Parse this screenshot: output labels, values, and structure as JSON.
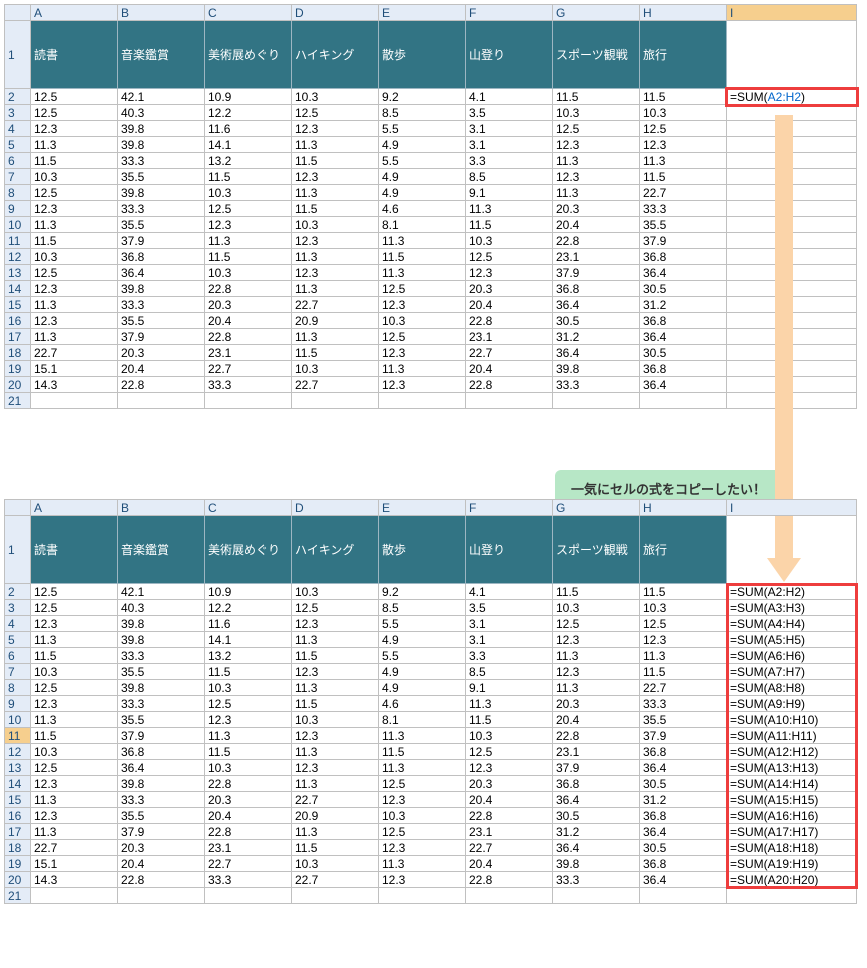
{
  "columns": [
    "A",
    "B",
    "C",
    "D",
    "E",
    "F",
    "G",
    "H",
    "I"
  ],
  "headers": [
    "読書",
    "音楽鑑賞",
    "美術展めぐり",
    "ハイキング",
    "散歩",
    "山登り",
    "スポーツ観戦",
    "旅行"
  ],
  "rows": [
    [
      "12.5",
      "42.1",
      "10.9",
      "10.3",
      "9.2",
      "4.1",
      "11.5",
      "11.5"
    ],
    [
      "12.5",
      "40.3",
      "12.2",
      "12.5",
      "8.5",
      "3.5",
      "10.3",
      "10.3"
    ],
    [
      "12.3",
      "39.8",
      "11.6",
      "12.3",
      "5.5",
      "3.1",
      "12.5",
      "12.5"
    ],
    [
      "11.3",
      "39.8",
      "14.1",
      "11.3",
      "4.9",
      "3.1",
      "12.3",
      "12.3"
    ],
    [
      "11.5",
      "33.3",
      "13.2",
      "11.5",
      "5.5",
      "3.3",
      "11.3",
      "11.3"
    ],
    [
      "10.3",
      "35.5",
      "11.5",
      "12.3",
      "4.9",
      "8.5",
      "12.3",
      "11.5"
    ],
    [
      "12.5",
      "39.8",
      "10.3",
      "11.3",
      "4.9",
      "9.1",
      "11.3",
      "22.7"
    ],
    [
      "12.3",
      "33.3",
      "12.5",
      "11.5",
      "4.6",
      "11.3",
      "20.3",
      "33.3"
    ],
    [
      "11.3",
      "35.5",
      "12.3",
      "10.3",
      "8.1",
      "11.5",
      "20.4",
      "35.5"
    ],
    [
      "11.5",
      "37.9",
      "11.3",
      "12.3",
      "11.3",
      "10.3",
      "22.8",
      "37.9"
    ],
    [
      "10.3",
      "36.8",
      "11.5",
      "11.3",
      "11.5",
      "12.5",
      "23.1",
      "36.8"
    ],
    [
      "12.5",
      "36.4",
      "10.3",
      "12.3",
      "11.3",
      "12.3",
      "37.9",
      "36.4"
    ],
    [
      "12.3",
      "39.8",
      "22.8",
      "11.3",
      "12.5",
      "20.3",
      "36.8",
      "30.5"
    ],
    [
      "11.3",
      "33.3",
      "20.3",
      "22.7",
      "12.3",
      "20.4",
      "36.4",
      "31.2"
    ],
    [
      "12.3",
      "35.5",
      "20.4",
      "20.9",
      "10.3",
      "22.8",
      "30.5",
      "36.8"
    ],
    [
      "11.3",
      "37.9",
      "22.8",
      "11.3",
      "12.5",
      "23.1",
      "31.2",
      "36.4"
    ],
    [
      "22.7",
      "20.3",
      "23.1",
      "11.5",
      "12.3",
      "22.7",
      "36.4",
      "30.5"
    ],
    [
      "15.1",
      "20.4",
      "22.7",
      "10.3",
      "11.3",
      "20.4",
      "39.8",
      "36.8"
    ],
    [
      "14.3",
      "22.8",
      "33.3",
      "22.7",
      "12.3",
      "22.8",
      "33.3",
      "36.4"
    ]
  ],
  "formula": {
    "prefix": "=SUM(",
    "ref": "A2:H2",
    "suffix": ")"
  },
  "formulas_bottom": [
    "=SUM(A2:H2)",
    "=SUM(A3:H3)",
    "=SUM(A4:H4)",
    "=SUM(A5:H5)",
    "=SUM(A6:H6)",
    "=SUM(A7:H7)",
    "=SUM(A8:H8)",
    "=SUM(A9:H9)",
    "=SUM(A10:H10)",
    "=SUM(A11:H11)",
    "=SUM(A12:H12)",
    "=SUM(A13:H13)",
    "=SUM(A14:H14)",
    "=SUM(A15:H15)",
    "=SUM(A16:H16)",
    "=SUM(A17:H17)",
    "=SUM(A18:H18)",
    "=SUM(A19:H19)",
    "=SUM(A20:H20)"
  ],
  "callout": "一気にセルの式をコピーしたい！",
  "bottom_highlight_row": 11
}
